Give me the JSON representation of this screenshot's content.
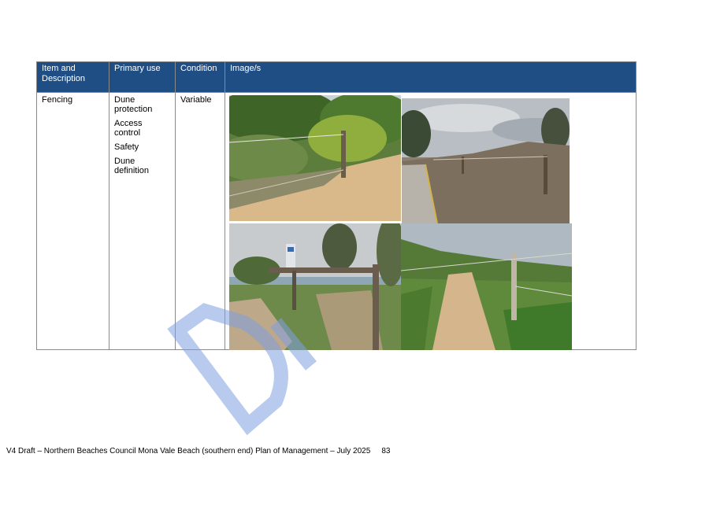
{
  "table": {
    "headers": [
      "Item and Description",
      "Primary use",
      "Condition",
      "Image/s"
    ],
    "rows": [
      {
        "item": "Fencing",
        "uses": [
          "Dune protection",
          "Access control",
          "Safety",
          "Dune definition"
        ],
        "condition": "Variable",
        "images": [
          "dune-fence-photo-1",
          "dune-fence-photo-2",
          "dune-fence-photo-3",
          "dune-fence-photo-4"
        ]
      }
    ]
  },
  "watermark": {
    "text": "DRAFT",
    "color": "#7f9fe0"
  },
  "footer": {
    "text": "V4 Draft – Northern Beaches Council Mona Vale Beach (southern end) Plan of Management – July 2025",
    "page_number": "83"
  },
  "colors": {
    "header_bg": "#1f4e85",
    "header_text": "#ffffff",
    "border": "#8a8a8a"
  }
}
